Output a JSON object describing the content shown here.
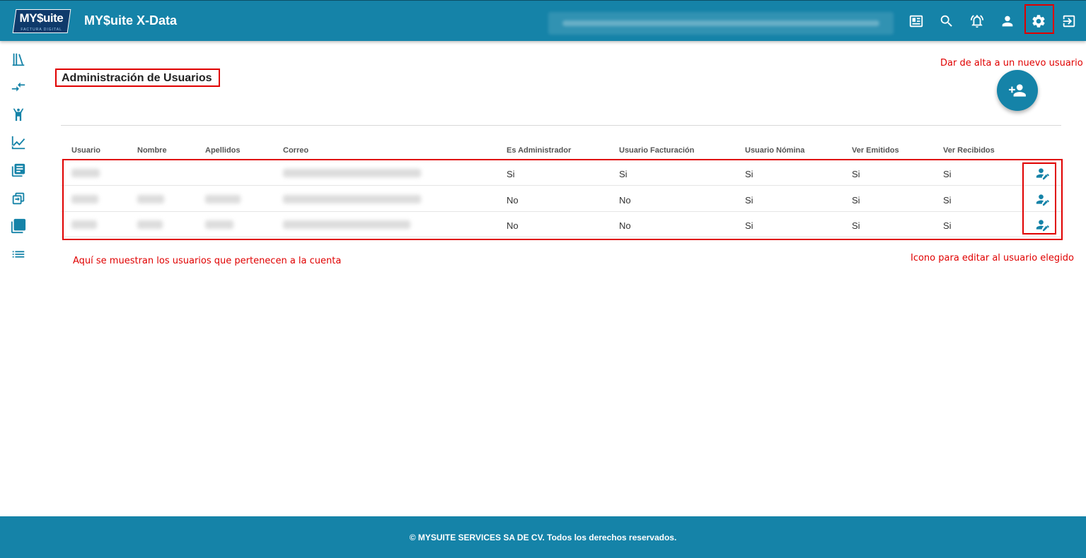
{
  "header": {
    "logo_text": "MY$uite",
    "logo_sub": "FACTURA DIGITAL",
    "app_title": "MY$uite X-Data",
    "icons": [
      "news-icon",
      "search-icon",
      "notifications-icon",
      "account-icon",
      "gear-icon",
      "logout-icon"
    ]
  },
  "sidebar": {
    "icons": [
      "library-icon",
      "compare-arrows-icon",
      "person-raised-icon",
      "chart-line-icon",
      "document-list-icon",
      "converter-icon",
      "stacked-pages-icon",
      "list-icon"
    ]
  },
  "page": {
    "title": "Administración de Usuarios"
  },
  "annotations": {
    "add_user_hint": "Dar de alta a un nuevo usuario",
    "rows_hint": "Aquí se muestran los usuarios que pertenecen a la cuenta",
    "edit_hint": "Icono para editar al usuario elegido"
  },
  "table": {
    "columns": [
      "Usuario",
      "Nombre",
      "Apellidos",
      "Correo",
      "Es Administrador",
      "Usuario Facturación",
      "Usuario Nómina",
      "Ver Emitidos",
      "Ver Recibidos"
    ],
    "rows": [
      {
        "es_administrador": "Si",
        "usuario_facturacion": "Si",
        "usuario_nomina": "Si",
        "ver_emitidos": "Si",
        "ver_recibidos": "Si"
      },
      {
        "es_administrador": "No",
        "usuario_facturacion": "No",
        "usuario_nomina": "Si",
        "ver_emitidos": "Si",
        "ver_recibidos": "Si"
      },
      {
        "es_administrador": "No",
        "usuario_facturacion": "No",
        "usuario_nomina": "Si",
        "ver_emitidos": "Si",
        "ver_recibidos": "Si"
      }
    ]
  },
  "footer": {
    "text": "© MYSUITE SERVICES SA DE CV. Todos los derechos reservados."
  },
  "colors": {
    "brand": "#1583a8",
    "annotation_red": "#e00000"
  }
}
